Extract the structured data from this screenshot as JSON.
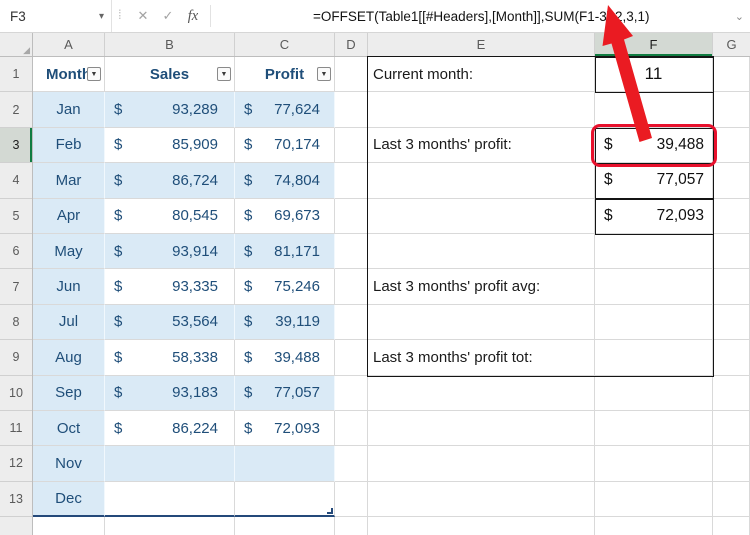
{
  "currency": "$",
  "formula_bar": {
    "name_box": "F3",
    "caret": "▾",
    "dots": "⁞",
    "cancel": "✕",
    "enter": "✓",
    "fx": "fx",
    "formula": "=OFFSET(Table1[[#Headers],[Month]],SUM(F1-3),2,3,1)",
    "expand": "⌄"
  },
  "grid": {
    "corner_triangle": "◢",
    "cols": [
      "A",
      "B",
      "C",
      "D",
      "E",
      "F",
      "G"
    ],
    "rows": [
      "1",
      "2",
      "3",
      "4",
      "5",
      "6",
      "7",
      "8",
      "9",
      "10",
      "11",
      "12",
      "13"
    ]
  },
  "table": {
    "headers": {
      "month": "Month",
      "sales": "Sales",
      "profit": "Profit"
    },
    "filter_glyph": "▼",
    "rows": [
      {
        "month": "Jan",
        "sales": "93,289",
        "profit": "77,624"
      },
      {
        "month": "Feb",
        "sales": "85,909",
        "profit": "70,174"
      },
      {
        "month": "Mar",
        "sales": "86,724",
        "profit": "74,804"
      },
      {
        "month": "Apr",
        "sales": "80,545",
        "profit": "69,673"
      },
      {
        "month": "May",
        "sales": "93,914",
        "profit": "81,171"
      },
      {
        "month": "Jun",
        "sales": "93,335",
        "profit": "75,246"
      },
      {
        "month": "Jul",
        "sales": "53,564",
        "profit": "39,119"
      },
      {
        "month": "Aug",
        "sales": "58,338",
        "profit": "39,488"
      },
      {
        "month": "Sep",
        "sales": "93,183",
        "profit": "77,057"
      },
      {
        "month": "Oct",
        "sales": "86,224",
        "profit": "72,093"
      },
      {
        "month": "Nov",
        "sales": "",
        "profit": ""
      },
      {
        "month": "Dec",
        "sales": "",
        "profit": ""
      }
    ]
  },
  "panel": {
    "current_month_label": "Current month:",
    "current_month_value": "11",
    "profit_label": "Last 3 months' profit:",
    "profit_values": [
      "39,488",
      "77,057",
      "72,093"
    ],
    "avg_label": "Last 3 months' profit avg:",
    "tot_label": "Last 3 months' profit tot:"
  },
  "colors": {
    "band_blue": "#DAEAF6",
    "table_text_navy": "#1F4E79",
    "annotation_red": "#E8112D",
    "selection_green": "#107C41"
  }
}
